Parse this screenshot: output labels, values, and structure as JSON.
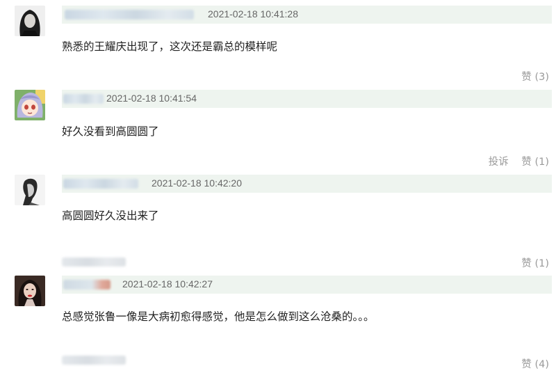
{
  "comments": [
    {
      "username": "",
      "timestamp": "2021-02-18 10:41:28",
      "text": "熟悉的王耀庆出现了，这次还是霸总的模样呢",
      "like_label": "赞 (3)",
      "report_label": ""
    },
    {
      "username": "",
      "timestamp": "2021-02-18 10:41:54",
      "text": "好久没看到高圆圆了",
      "like_label": "赞 (1)",
      "report_label": "投诉"
    },
    {
      "username": "",
      "timestamp": "2021-02-18 10:42:20",
      "text": "高圆圆好久没出来了",
      "like_label": "赞 (1)",
      "report_label": ""
    },
    {
      "username": "",
      "timestamp": "2021-02-18 10:42:27",
      "text": "总感觉张鲁一像是大病初愈得感觉，他是怎么做到这么沧桑的。。。",
      "like_label": "赞 (4)",
      "report_label": ""
    }
  ],
  "colors": {
    "meta_bar": "#eef4ef",
    "timestamp": "#666666",
    "action_text": "#9a9a9a",
    "body_text": "#222222"
  },
  "icons": [
    "avatar-woman-dark-hair",
    "avatar-anime-girl",
    "avatar-bw-portrait",
    "avatar-woman-red-lips"
  ]
}
